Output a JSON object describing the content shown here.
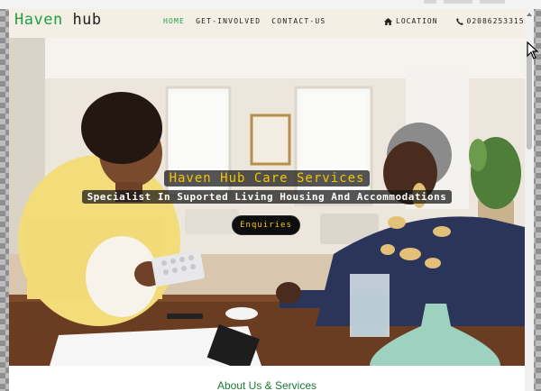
{
  "brand": {
    "part1": "Haven",
    "part2": "hub",
    "color_accent": "#1ea245"
  },
  "nav": {
    "items": [
      {
        "label": "HOME",
        "active": true
      },
      {
        "label": "GET-INVOLVED",
        "active": false
      },
      {
        "label": "CONTACT-US",
        "active": false
      }
    ],
    "location_label": "LOCATION",
    "location_icon": "home-icon",
    "phone": "02086253315",
    "phone_icon": "phone-icon"
  },
  "hero": {
    "title": "Haven Hub Care Services",
    "subtitle": "Specialist In Suported Living Housing And Accommodations",
    "button_label": "Enquiries",
    "title_color": "#f5c400"
  },
  "about": {
    "heading": "About Us & Services"
  }
}
